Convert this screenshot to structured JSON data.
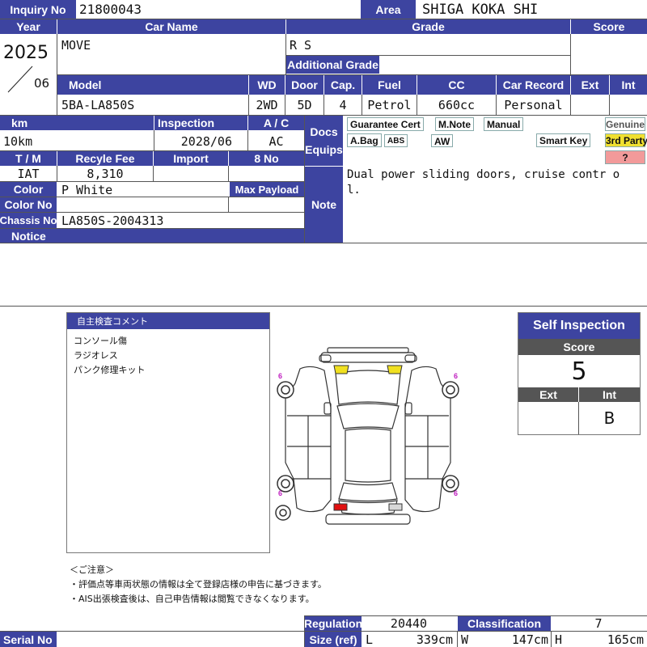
{
  "header": {
    "inquiry_label": "Inquiry No",
    "inquiry_no": "21800043",
    "area_label": "Area",
    "area": "SHIGA KOKA SHI"
  },
  "row1": {
    "year_label": "Year",
    "car_name_label": "Car Name",
    "grade_label": "Grade",
    "score_label": "Score",
    "year": "2025",
    "month": "06",
    "car_name": "MOVE",
    "grade": "R S",
    "additional_grade_label": "Additional Grade"
  },
  "row2": {
    "model_label": "Model",
    "wd_label": "WD",
    "door_label": "Door",
    "cap_label": "Cap.",
    "fuel_label": "Fuel",
    "cc_label": "CC",
    "car_record_label": "Car Record",
    "ext_label": "Ext",
    "int_label": "Int",
    "model": "5BA-LA850S",
    "wd": "2WD",
    "door": "5D",
    "cap": "4",
    "fuel": "Petrol",
    "cc": "660cc",
    "car_record": "Personal"
  },
  "specs": {
    "km_label": "km",
    "inspection_label": "Inspection",
    "ac_label": "A / C",
    "km": "10km",
    "inspection": "2028/06",
    "ac": "AC",
    "tm_label": "T / M",
    "recycle_label": "Recyle Fee",
    "import_label": "Import",
    "no8_label": "8 No",
    "tm": "IAT",
    "recycle": "8,310",
    "color_label": "Color",
    "color": "P White",
    "max_payload_label": "Max Payload",
    "color_no_label": "Color No",
    "chassis_label": "Chassis No",
    "chassis": "LA850S-2004313",
    "notice_label": "Notice"
  },
  "equips": {
    "label_1": "Docs",
    "label_2": "Equips",
    "items": [
      "Guarantee Cert",
      "M.Note",
      "Manual",
      "A.Bag",
      "ABS",
      "AW",
      "Smart Key"
    ],
    "genuine": "Genuine",
    "third_party": "3rd Party",
    "unknown": "?"
  },
  "note": {
    "label": "Note",
    "text": "Dual power sliding doors, cruise contr ol."
  },
  "comment": {
    "title": "自主検査コメント",
    "lines": [
      "コンソール傷",
      "ラジオレス",
      "パンク修理キット"
    ]
  },
  "diagram": {
    "tire_marks": [
      "6",
      "6",
      "6",
      "6"
    ]
  },
  "self_inspection": {
    "title": "Self Inspection",
    "score_label": "Score",
    "score": "5",
    "ext_label": "Ext",
    "int_label": "Int",
    "ext": "",
    "int": "B"
  },
  "caution": {
    "title": "＜ご注意＞",
    "lines": [
      "・評価点等車両状態の情報は全て登録店様の申告に基づきます。",
      "・AIS出張検査後は、自己申告情報は閲覧できなくなります。"
    ]
  },
  "footer": {
    "regulation_label": "Regulation",
    "regulation": "20440",
    "classification_label": "Classification",
    "classification": "7",
    "serial_label": "Serial No",
    "size_label": "Size (ref)",
    "l_label": "L",
    "l": "339cm",
    "w_label": "W",
    "w": "147cm",
    "h_label": "H",
    "h": "165cm"
  },
  "colors": {
    "header_blue": "#3d44a0",
    "equip_bg": "#cfe0f5",
    "third_party": "#f0e030",
    "unknown": "#f29a9a",
    "damage_red": "#e01010",
    "damage_yellow": "#f0e020",
    "tire_mark": "#c020c0"
  }
}
